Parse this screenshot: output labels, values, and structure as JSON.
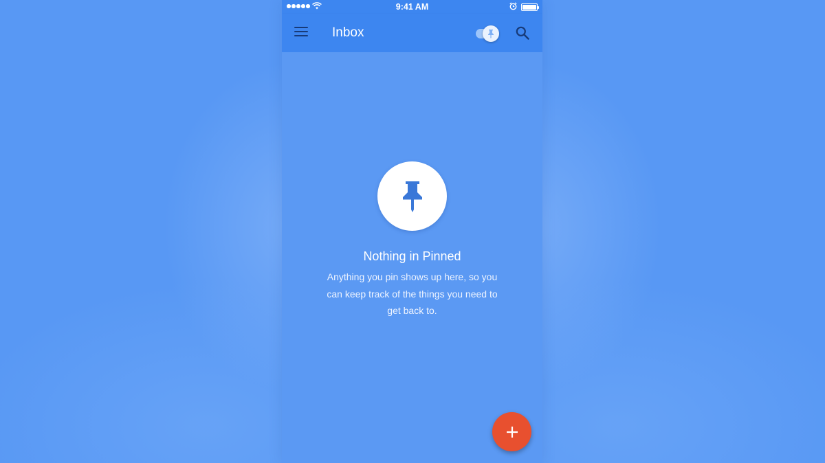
{
  "status_bar": {
    "time": "9:41 AM",
    "signal_icon": "signal-dots-icon",
    "wifi_icon": "wifi-icon",
    "alarm_icon": "alarm-clock-icon",
    "battery_icon": "battery-icon"
  },
  "app_bar": {
    "title": "Inbox",
    "menu_icon": "hamburger-menu-icon",
    "toggle_icon": "pin-toggle-icon",
    "search_icon": "search-icon",
    "background_color": "#3d86f0"
  },
  "empty_state": {
    "icon": "pushpin-icon",
    "title": "Nothing in Pinned",
    "message": "Anything you pin shows up here, so you can keep track of the things you need to get back to."
  },
  "fab": {
    "icon": "plus-icon",
    "color": "#e8502f"
  },
  "colors": {
    "background": "#5b99f3",
    "pin_icon": "#3a78d8"
  }
}
